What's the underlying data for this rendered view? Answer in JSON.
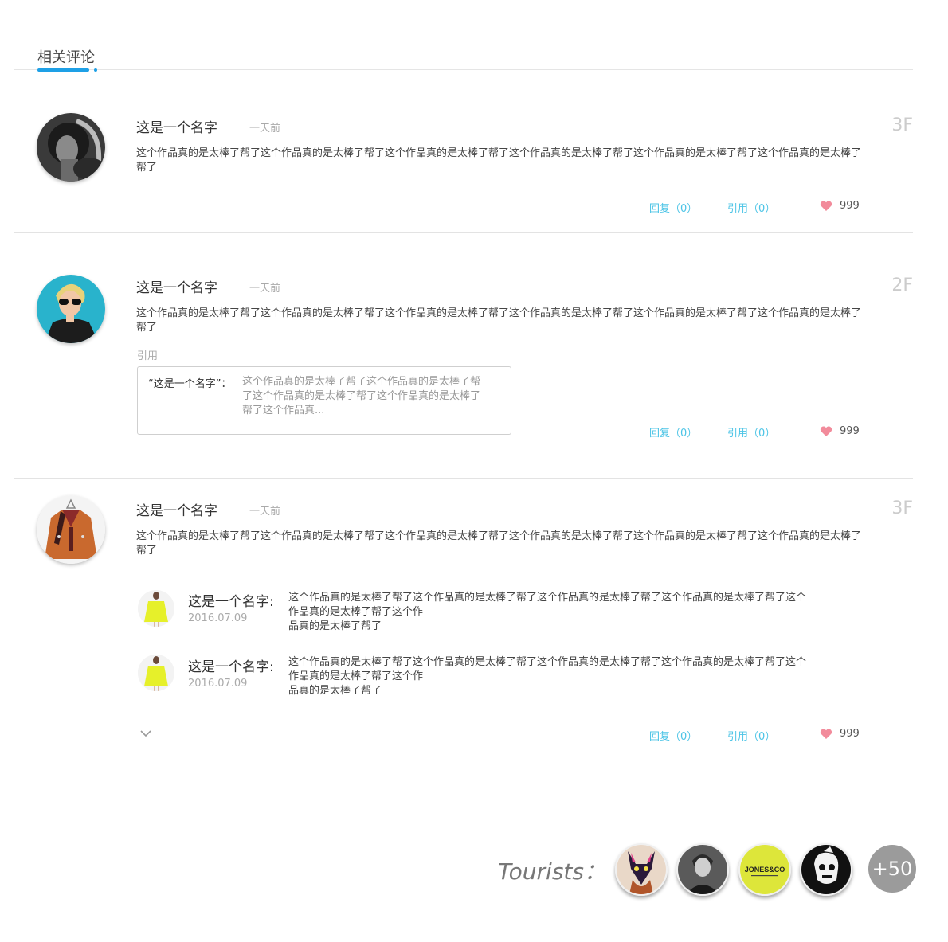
{
  "tab": {
    "title": "相关评论"
  },
  "comments": [
    {
      "name": "这是一个名字",
      "time": "一天前",
      "floor": "3F",
      "content": "这个作品真的是太棒了帮了这个作品真的是太棒了帮了这个作品真的是太棒了帮了这个作品真的是太棒了帮了这个作品真的是太棒了帮了这个作品真的是太棒了帮了",
      "reply_label": "回复（0）",
      "quote_label": "引用（0）",
      "likes": "999"
    },
    {
      "name": "这是一个名字",
      "time": "一天前",
      "floor": "2F",
      "content": "这个作品真的是太棒了帮了这个作品真的是太棒了帮了这个作品真的是太棒了帮了这个作品真的是太棒了帮了这个作品真的是太棒了帮了这个作品真的是太棒了帮了",
      "quote_heading": "引用",
      "quote": {
        "name": "“这是一个名字”：",
        "text": "这个作品真的是太棒了帮了这个作品真的是太棒了帮了这个作品真的是太棒了帮了这个作品真的是太棒了帮了这个作品真..."
      },
      "reply_label": "回复（0）",
      "quote_label": "引用（0）",
      "likes": "999"
    },
    {
      "name": "这是一个名字",
      "time": "一天前",
      "floor": "3F",
      "content": "这个作品真的是太棒了帮了这个作品真的是太棒了帮了这个作品真的是太棒了帮了这个作品真的是太棒了帮了这个作品真的是太棒了帮了这个作品真的是太棒了帮了",
      "replies": [
        {
          "name": "这是一个名字:",
          "date": "2016.07.09",
          "text_line1": "这个作品真的是太棒了帮了这个作品真的是太棒了帮了这个作品真的是太棒了帮了这个作品真的是太棒了帮了这个",
          "text_line2": "作品真的是太棒了帮了这个作",
          "text_line3": "品真的是太棒了帮了"
        },
        {
          "name": "这是一个名字:",
          "date": "2016.07.09",
          "text_line1": "这个作品真的是太棒了帮了这个作品真的是太棒了帮了这个作品真的是太棒了帮了这个作品真的是太棒了帮了这个",
          "text_line2": "作品真的是太棒了帮了这个作",
          "text_line3": "品真的是太棒了帮了"
        }
      ],
      "reply_label": "回复（0）",
      "quote_label": "引用（0）",
      "likes": "999"
    }
  ],
  "tourists": {
    "label": "Tourists：",
    "more": "+50",
    "avatar_icons": [
      "fox-mask-avatar-icon",
      "person-avatar-icon",
      "jones-and-co-logo-icon",
      "skull-cartoon-avatar-icon"
    ],
    "jones_logo_text": "JONES&CO"
  },
  "colors": {
    "accent": "#1ea0e6",
    "link": "#4cc4e6",
    "heart": "#f28b9b"
  }
}
